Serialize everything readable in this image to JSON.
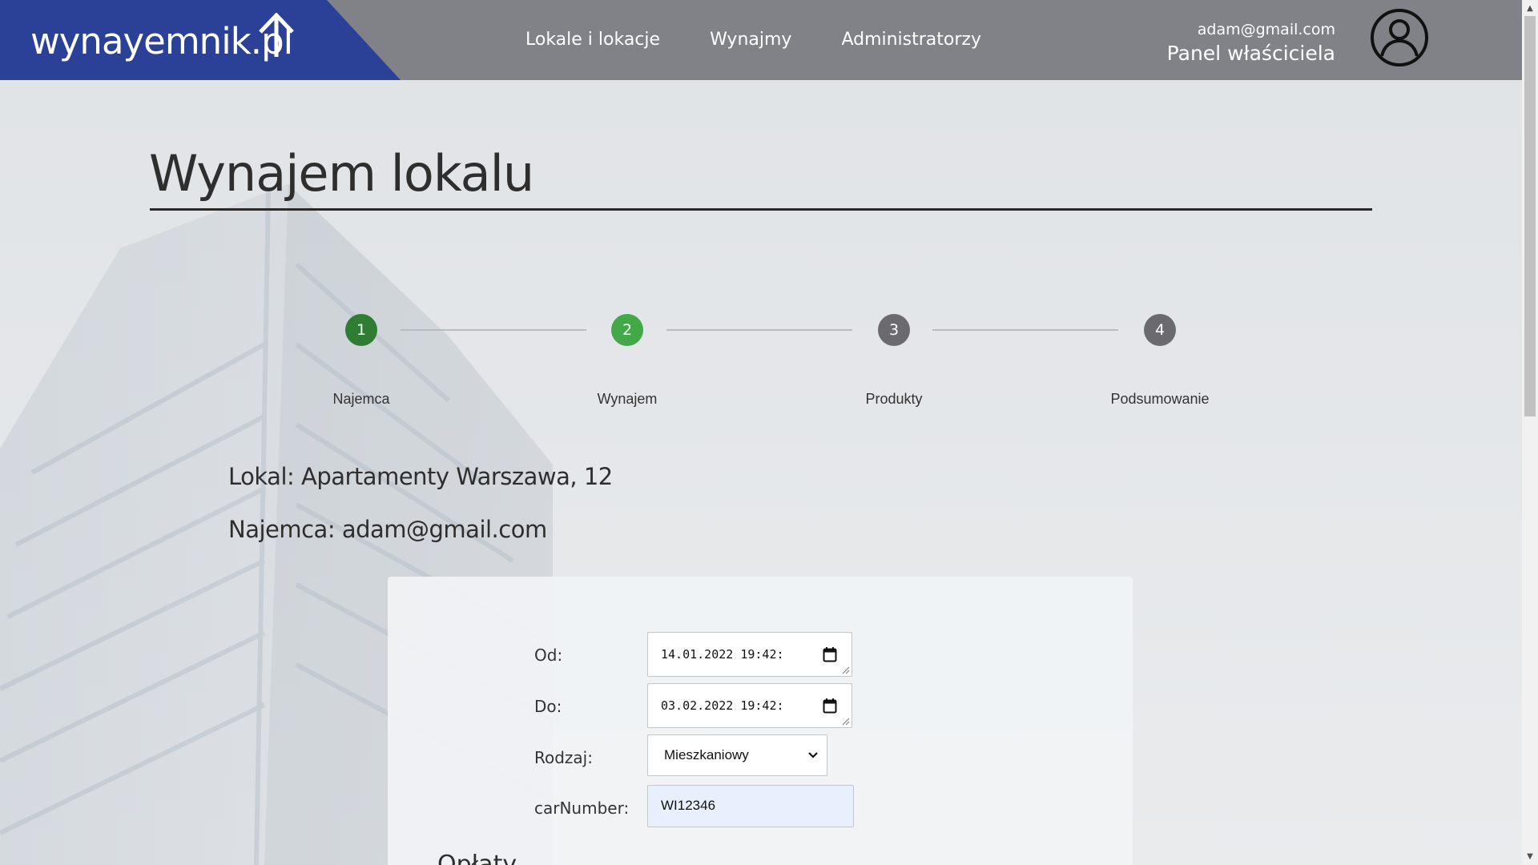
{
  "brand": {
    "logo_text": "wynayemnik.pl",
    "primary_color": "#2b4198",
    "header_color": "#808288"
  },
  "nav": {
    "items": [
      {
        "label": "Lokale i lokacje"
      },
      {
        "label": "Wynajmy"
      },
      {
        "label": "Administratorzy"
      }
    ]
  },
  "user": {
    "email": "adam@gmail.com",
    "panel_label": "Panel właściciela",
    "avatar_icon": "user-circle-icon"
  },
  "page": {
    "title": "Wynajem lokalu"
  },
  "stepper": {
    "steps": [
      {
        "number": "1",
        "label": "Najemca",
        "state": "completed",
        "color": "#2e7d32"
      },
      {
        "number": "2",
        "label": "Wynajem",
        "state": "active",
        "color": "#43a847"
      },
      {
        "number": "3",
        "label": "Produkty",
        "state": "pending",
        "color": "#6b6b6f"
      },
      {
        "number": "4",
        "label": "Podsumowanie",
        "state": "pending",
        "color": "#6b6b6f"
      }
    ]
  },
  "info": {
    "lokal": "Lokal: Apartamenty Warszawa, 12",
    "najemca": "Najemca: adam@gmail.com"
  },
  "form": {
    "od": {
      "label": "Od:",
      "value": "14.01.2022 19:42:"
    },
    "do": {
      "label": "Do:",
      "value": "03.02.2022 19:42:"
    },
    "rodzaj": {
      "label": "Rodzaj:",
      "value": "Mieszkaniowy"
    },
    "car_number": {
      "label": "carNumber:",
      "value": "WI12346"
    }
  },
  "sections": {
    "oplaty": "Opłaty"
  }
}
